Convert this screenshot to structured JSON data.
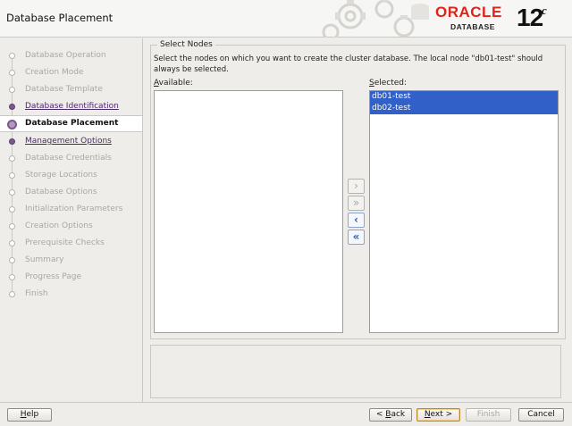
{
  "window": {
    "title": "Database Placement"
  },
  "brand": {
    "oracle": "ORACLE",
    "database": "DATABASE",
    "version": "12",
    "version_suffix": "c"
  },
  "steps": [
    {
      "label": "Database Operation",
      "state": "disabled"
    },
    {
      "label": "Creation Mode",
      "state": "disabled"
    },
    {
      "label": "Database Template",
      "state": "disabled"
    },
    {
      "label": "Database Identification",
      "state": "visited"
    },
    {
      "label": "Database Placement",
      "state": "current"
    },
    {
      "label": "Management Options",
      "state": "visited"
    },
    {
      "label": "Database Credentials",
      "state": "disabled"
    },
    {
      "label": "Storage Locations",
      "state": "disabled"
    },
    {
      "label": "Database Options",
      "state": "disabled"
    },
    {
      "label": "Initialization Parameters",
      "state": "disabled"
    },
    {
      "label": "Creation Options",
      "state": "disabled"
    },
    {
      "label": "Prerequisite Checks",
      "state": "disabled"
    },
    {
      "label": "Summary",
      "state": "disabled"
    },
    {
      "label": "Progress Page",
      "state": "disabled"
    },
    {
      "label": "Finish",
      "state": "disabled"
    }
  ],
  "main": {
    "group_title": "Select Nodes",
    "description": "Select the nodes on which you want to create the cluster database. The local node \"db01-test\" should always be selected.",
    "available_label": "Available:",
    "selected_label": "Selected:",
    "available_items": [],
    "selected_items": [
      "db01-test",
      "db02-test"
    ],
    "shuttle_buttons": [
      {
        "symbol": "›",
        "name": "move-right-button",
        "active": false
      },
      {
        "symbol": "»",
        "name": "move-all-right-button",
        "active": false
      },
      {
        "symbol": "‹",
        "name": "move-left-button",
        "active": true
      },
      {
        "symbol": "«",
        "name": "move-all-left-button",
        "active": true
      }
    ]
  },
  "buttons": {
    "help": "Help",
    "back": "< Back",
    "next": "Next >",
    "finish": "Finish",
    "cancel": "Cancel"
  },
  "colors": {
    "oracle_red": "#e0231b",
    "selection": "#3060c8",
    "visited_link": "#4b2a68"
  }
}
